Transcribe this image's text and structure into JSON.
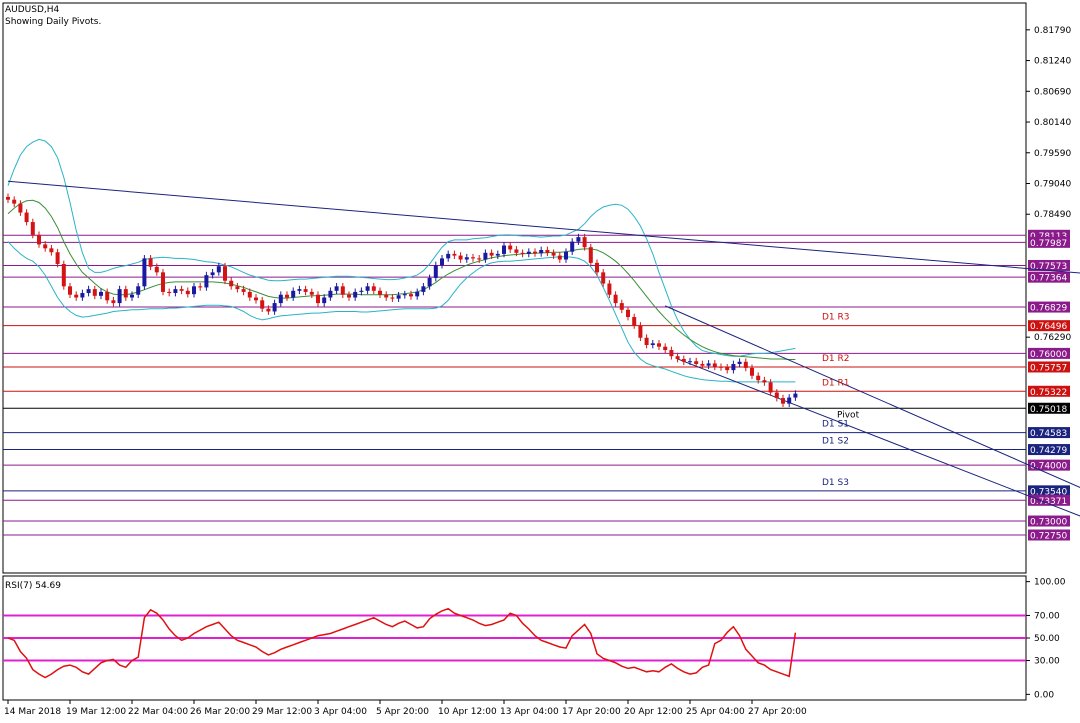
{
  "chart_data": {
    "type": "candlestick",
    "symbol_label": "AUDUSD,H4",
    "subtitle": "Showing Daily Pivots.",
    "price_axis": {
      "ylim": [
        0.7207,
        0.8227
      ],
      "tick_values": [
        0.8179,
        0.8124,
        0.8069,
        0.8014,
        0.7959,
        0.7904,
        0.7849,
        0.7629
      ],
      "tick_labels": [
        "0.81790",
        "0.81240",
        "0.80690",
        "0.80140",
        "0.79590",
        "0.79040",
        "0.78490",
        "0.76290"
      ]
    },
    "x_axis": {
      "labels": [
        "14 Mar 2018",
        "19 Mar 12:00",
        "22 Mar 04:00",
        "26 Mar 20:00",
        "29 Mar 12:00",
        "3 Apr 04:00",
        "5 Apr 20:00",
        "10 Apr 12:00",
        "13 Apr 04:00",
        "17 Apr 20:00",
        "20 Apr 12:00",
        "25 Apr 04:00",
        "27 Apr 20:00"
      ],
      "label_index": [
        0,
        10,
        20,
        30,
        40,
        50,
        60,
        70,
        80,
        90,
        100,
        110,
        120
      ]
    },
    "levels": [
      {
        "value": 0.78113,
        "label": "0.78113",
        "kind": "purple"
      },
      {
        "value": 0.77987,
        "label": "0.77987",
        "kind": "purple"
      },
      {
        "value": 0.77573,
        "label": "0.77573",
        "kind": "purple"
      },
      {
        "value": 0.77364,
        "label": "0.77364",
        "kind": "purple"
      },
      {
        "value": 0.76829,
        "label": "0.76829",
        "kind": "purple"
      },
      {
        "value": 0.76496,
        "label": "0.76496",
        "kind": "red"
      },
      {
        "value": 0.76,
        "label": "0.76000",
        "kind": "purple"
      },
      {
        "value": 0.75757,
        "label": "0.75757",
        "kind": "red"
      },
      {
        "value": 0.75322,
        "label": "0.75322",
        "kind": "red"
      },
      {
        "value": 0.75018,
        "label": "0.75018",
        "kind": "current"
      },
      {
        "value": 0.74583,
        "label": "0.74583",
        "kind": "blue"
      },
      {
        "value": 0.74279,
        "label": "0.74279",
        "kind": "blue"
      },
      {
        "value": 0.74,
        "label": "0.74000",
        "kind": "purple"
      },
      {
        "value": 0.7354,
        "label": "0.73540",
        "kind": "blue"
      },
      {
        "value": 0.73371,
        "label": "0.73371",
        "kind": "purple"
      },
      {
        "value": 0.73,
        "label": "0.73000",
        "kind": "purple"
      },
      {
        "value": 0.7275,
        "label": "0.72750",
        "kind": "purple"
      }
    ],
    "pivots": [
      {
        "label": "D1 R3",
        "value": 0.76496
      },
      {
        "label": "D1 R2",
        "value": 0.75757
      },
      {
        "label": "D1 R1",
        "value": 0.75322
      },
      {
        "label": "Pivot",
        "value": 0.75018
      },
      {
        "label": "D1 S1",
        "value": 0.74583
      },
      {
        "label": "D1 S2",
        "value": 0.74279
      },
      {
        "label": "D1 S3",
        "value": 0.7354
      }
    ],
    "close_series": [
      0.7875,
      0.7868,
      0.7852,
      0.7835,
      0.7812,
      0.7795,
      0.7788,
      0.7781,
      0.776,
      0.772,
      0.7705,
      0.77,
      0.7708,
      0.7715,
      0.7703,
      0.771,
      0.7695,
      0.769,
      0.7715,
      0.77,
      0.7705,
      0.772,
      0.777,
      0.7755,
      0.7745,
      0.771,
      0.7708,
      0.7715,
      0.7712,
      0.7706,
      0.772,
      0.7718,
      0.774,
      0.7745,
      0.7756,
      0.773,
      0.772,
      0.7715,
      0.771,
      0.77,
      0.7695,
      0.768,
      0.7675,
      0.769,
      0.7705,
      0.77,
      0.7712,
      0.7715,
      0.771,
      0.7705,
      0.769,
      0.77,
      0.7712,
      0.772,
      0.7705,
      0.77,
      0.771,
      0.7712,
      0.772,
      0.7712,
      0.7705,
      0.77,
      0.7698,
      0.7704,
      0.7706,
      0.7702,
      0.771,
      0.772,
      0.7735,
      0.7758,
      0.777,
      0.7778,
      0.7775,
      0.7768,
      0.7772,
      0.777,
      0.7768,
      0.778,
      0.7775,
      0.7778,
      0.7793,
      0.7786,
      0.778,
      0.7778,
      0.7782,
      0.7779,
      0.7785,
      0.778,
      0.7775,
      0.7768,
      0.7782,
      0.78,
      0.7808,
      0.779,
      0.7762,
      0.7745,
      0.7725,
      0.7705,
      0.769,
      0.7678,
      0.7665,
      0.765,
      0.7628,
      0.7615,
      0.7618,
      0.7612,
      0.7606,
      0.7595,
      0.759,
      0.7585,
      0.7586,
      0.7581,
      0.7578,
      0.7582,
      0.7576,
      0.7575,
      0.757,
      0.7581,
      0.7585,
      0.7574,
      0.756,
      0.7552,
      0.7548,
      0.753,
      0.752,
      0.751,
      0.7521,
      0.7528
    ],
    "upper_band": [
      0.79,
      0.793,
      0.7955,
      0.797,
      0.7978,
      0.7983,
      0.798,
      0.797,
      0.795,
      0.7915,
      0.787,
      0.782,
      0.778,
      0.7752,
      0.7745,
      0.7745,
      0.7748,
      0.7752,
      0.7755,
      0.7757,
      0.776,
      0.7763,
      0.7768,
      0.777,
      0.7771,
      0.7772,
      0.7771,
      0.777,
      0.777,
      0.7769,
      0.7768,
      0.7766,
      0.7764,
      0.7763,
      0.7761,
      0.7758,
      0.7755,
      0.775,
      0.7745,
      0.774,
      0.7737,
      0.7734,
      0.7731,
      0.773,
      0.773,
      0.7731,
      0.7732,
      0.7733,
      0.7733,
      0.7734,
      0.7735,
      0.7736,
      0.7737,
      0.7738,
      0.7738,
      0.7738,
      0.7737,
      0.7736,
      0.7735,
      0.7734,
      0.7733,
      0.7732,
      0.7732,
      0.7733,
      0.7735,
      0.7737,
      0.774,
      0.7748,
      0.776,
      0.7775,
      0.779,
      0.78,
      0.7803,
      0.7803,
      0.7803,
      0.7805,
      0.7806,
      0.7807,
      0.7809,
      0.7811,
      0.7812,
      0.7812,
      0.7811,
      0.781,
      0.781,
      0.7809,
      0.7808,
      0.7809,
      0.781,
      0.781,
      0.7812,
      0.7817,
      0.7822,
      0.7832,
      0.7845,
      0.7855,
      0.7862,
      0.7865,
      0.7867,
      0.7865,
      0.7858,
      0.7845,
      0.7828,
      0.7805,
      0.7778,
      0.7745,
      0.7715,
      0.7685,
      0.766,
      0.764,
      0.7625,
      0.7613,
      0.7605,
      0.7602,
      0.76,
      0.7598,
      0.7596,
      0.7595,
      0.7595,
      0.7597,
      0.7599,
      0.76,
      0.76,
      0.7601,
      0.7603,
      0.7605,
      0.7607,
      0.7609
    ],
    "middle_band": [
      0.785,
      0.786,
      0.7868,
      0.7873,
      0.7874,
      0.787,
      0.786,
      0.7845,
      0.7825,
      0.78,
      0.7778,
      0.776,
      0.7745,
      0.7735,
      0.7725,
      0.7716,
      0.771,
      0.7706,
      0.7705,
      0.7705,
      0.7707,
      0.771,
      0.7714,
      0.7718,
      0.7722,
      0.7725,
      0.7727,
      0.7728,
      0.7728,
      0.7728,
      0.7728,
      0.7728,
      0.7728,
      0.7728,
      0.7727,
      0.7726,
      0.7724,
      0.7721,
      0.7718,
      0.7714,
      0.771,
      0.7706,
      0.7702,
      0.77,
      0.7699,
      0.7699,
      0.77,
      0.7701,
      0.7702,
      0.7703,
      0.7703,
      0.7704,
      0.7705,
      0.7706,
      0.7706,
      0.7706,
      0.7706,
      0.7705,
      0.7705,
      0.7705,
      0.7705,
      0.7705,
      0.7705,
      0.7706,
      0.7707,
      0.7708,
      0.771,
      0.7714,
      0.772,
      0.7727,
      0.7735,
      0.7742,
      0.7748,
      0.7753,
      0.7758,
      0.7762,
      0.7765,
      0.7768,
      0.7771,
      0.7773,
      0.7775,
      0.7776,
      0.7777,
      0.7778,
      0.7779,
      0.7779,
      0.778,
      0.778,
      0.7781,
      0.7781,
      0.7782,
      0.7784,
      0.7786,
      0.7787,
      0.7787,
      0.7785,
      0.778,
      0.7773,
      0.7765,
      0.7755,
      0.7743,
      0.773,
      0.7716,
      0.7702,
      0.7688,
      0.7675,
      0.7663,
      0.7652,
      0.7642,
      0.7633,
      0.7625,
      0.7618,
      0.7612,
      0.7607,
      0.7603,
      0.76,
      0.7598,
      0.7596,
      0.7595,
      0.7594,
      0.7593,
      0.7592,
      0.7591,
      0.759,
      0.759,
      0.759,
      0.7589,
      0.7589
    ],
    "lower_band": [
      0.78,
      0.7788,
      0.7778,
      0.777,
      0.7765,
      0.7755,
      0.774,
      0.772,
      0.77,
      0.7685,
      0.7675,
      0.7668,
      0.7665,
      0.7666,
      0.7668,
      0.767,
      0.7672,
      0.7675,
      0.7676,
      0.7677,
      0.7678,
      0.7678,
      0.7679,
      0.768,
      0.768,
      0.768,
      0.7681,
      0.7681,
      0.7682,
      0.7683,
      0.7684,
      0.7685,
      0.7686,
      0.7686,
      0.7686,
      0.7685,
      0.7684,
      0.768,
      0.7675,
      0.7668,
      0.7663,
      0.766,
      0.7662,
      0.7665,
      0.7667,
      0.7668,
      0.7669,
      0.767,
      0.7671,
      0.7672,
      0.7672,
      0.7673,
      0.7674,
      0.7675,
      0.7675,
      0.7675,
      0.7675,
      0.7674,
      0.7674,
      0.7675,
      0.7676,
      0.7677,
      0.7678,
      0.7679,
      0.768,
      0.768,
      0.768,
      0.768,
      0.768,
      0.7681,
      0.7685,
      0.7695,
      0.771,
      0.7724,
      0.7735,
      0.7744,
      0.7752,
      0.7758,
      0.7762,
      0.7764,
      0.7765,
      0.7765,
      0.7766,
      0.7767,
      0.7768,
      0.7769,
      0.777,
      0.7771,
      0.7772,
      0.7773,
      0.7773,
      0.7772,
      0.777,
      0.7765,
      0.7755,
      0.774,
      0.7718,
      0.7695,
      0.767,
      0.7645,
      0.762,
      0.7602,
      0.759,
      0.7582,
      0.7578,
      0.7575,
      0.7572,
      0.7568,
      0.7564,
      0.756,
      0.7557,
      0.7555,
      0.7553,
      0.7552,
      0.7551,
      0.755,
      0.755,
      0.7549,
      0.7549,
      0.7549,
      0.7549,
      0.7549,
      0.7549,
      0.7549,
      0.7549,
      0.7549,
      0.7549,
      0.7549
    ],
    "trendlines": [
      {
        "name": "long-resistance",
        "p1": [
          0,
          0.7908
        ],
        "p2": [
          180,
          0.7737
        ]
      },
      {
        "name": "channel-upper",
        "p1": [
          106,
          0.7685
        ],
        "p2": [
          175,
          0.735
        ]
      },
      {
        "name": "channel-lower",
        "p1": [
          108,
          0.759
        ],
        "p2": [
          175,
          0.73
        ]
      }
    ],
    "rsi": {
      "label": "RSI(7) 54.69",
      "ylim": [
        -5,
        105
      ],
      "tick_values": [
        100,
        70,
        50,
        30,
        0
      ],
      "tick_labels": [
        "100.00",
        "70.00",
        "50.00",
        "30.00",
        "0.00"
      ],
      "levels": [
        70,
        50,
        30
      ],
      "values": [
        50,
        48,
        38,
        32,
        22,
        18,
        15,
        18,
        22,
        25,
        26,
        24,
        20,
        18,
        23,
        28,
        30,
        31,
        26,
        24,
        30,
        33,
        68,
        75,
        72,
        66,
        58,
        52,
        48,
        50,
        54,
        57,
        60,
        62,
        64,
        58,
        52,
        48,
        46,
        44,
        42,
        38,
        35,
        37,
        40,
        42,
        44,
        46,
        48,
        50,
        52,
        53,
        54,
        56,
        58,
        60,
        62,
        64,
        66,
        68,
        65,
        62,
        60,
        63,
        65,
        62,
        59,
        60,
        67,
        71,
        74,
        76,
        72,
        70,
        68,
        66,
        63,
        61,
        62,
        64,
        66,
        72,
        70,
        63,
        58,
        52,
        48,
        46,
        44,
        42,
        41,
        52,
        57,
        62,
        54,
        36,
        32,
        30,
        28,
        25,
        23,
        24,
        22,
        20,
        21,
        20,
        24,
        27,
        23,
        20,
        18,
        19,
        24,
        26,
        45,
        48,
        55,
        60,
        52,
        40,
        34,
        28,
        26,
        22,
        20,
        18,
        16,
        54.69
      ]
    }
  }
}
